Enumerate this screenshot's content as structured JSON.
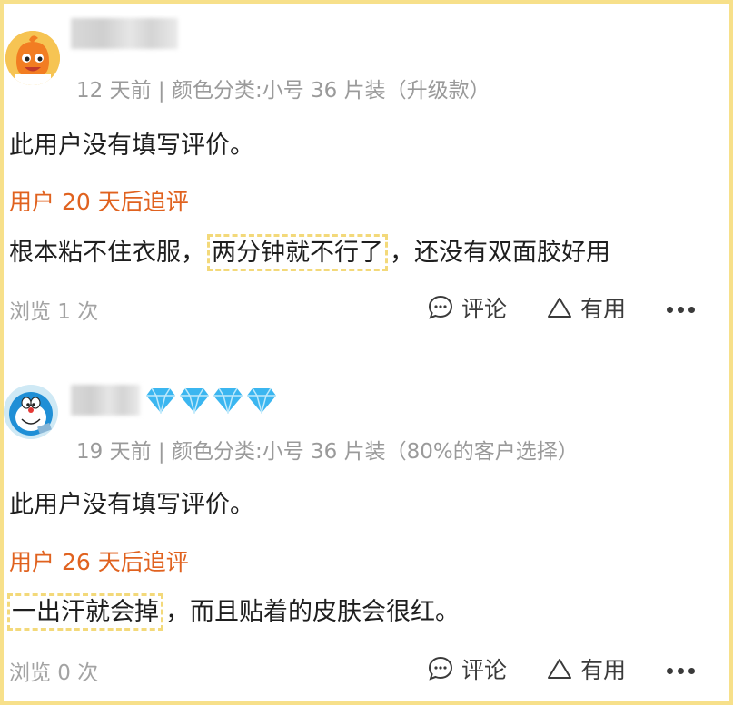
{
  "reviews": [
    {
      "meta": "12 天前 | 颜色分类:小号 36 片装（升级款）",
      "content": "此用户没有填写评价。",
      "followup_label": "用户 20 天后追评",
      "followup_pre": "根本粘不住衣服，",
      "followup_highlight": "两分钟就不行了",
      "followup_post": "，还没有双面胶好用",
      "views": "浏览 1 次",
      "comment_label": "评论",
      "useful_label": "有用",
      "avatar_icon": "orange-mascot-icon"
    },
    {
      "meta": "19 天前 | 颜色分类:小号 36 片装（80%的客户选择）",
      "content": "此用户没有填写评价。",
      "followup_label": "用户 26 天后追评",
      "followup_pre": "",
      "followup_highlight": "一出汗就会掉",
      "followup_post": "，而且贴着的皮肤会很红。",
      "views": "浏览 0 次",
      "comment_label": "评论",
      "useful_label": "有用",
      "avatar_icon": "doraemon-avatar-icon",
      "badge_count": 4
    }
  ],
  "colors": {
    "followup": "#e0621f",
    "meta": "#9a9a9a",
    "highlight_border": "#f3d97a",
    "diamond": "#3bb6f0",
    "page_border": "#f7e08a"
  }
}
